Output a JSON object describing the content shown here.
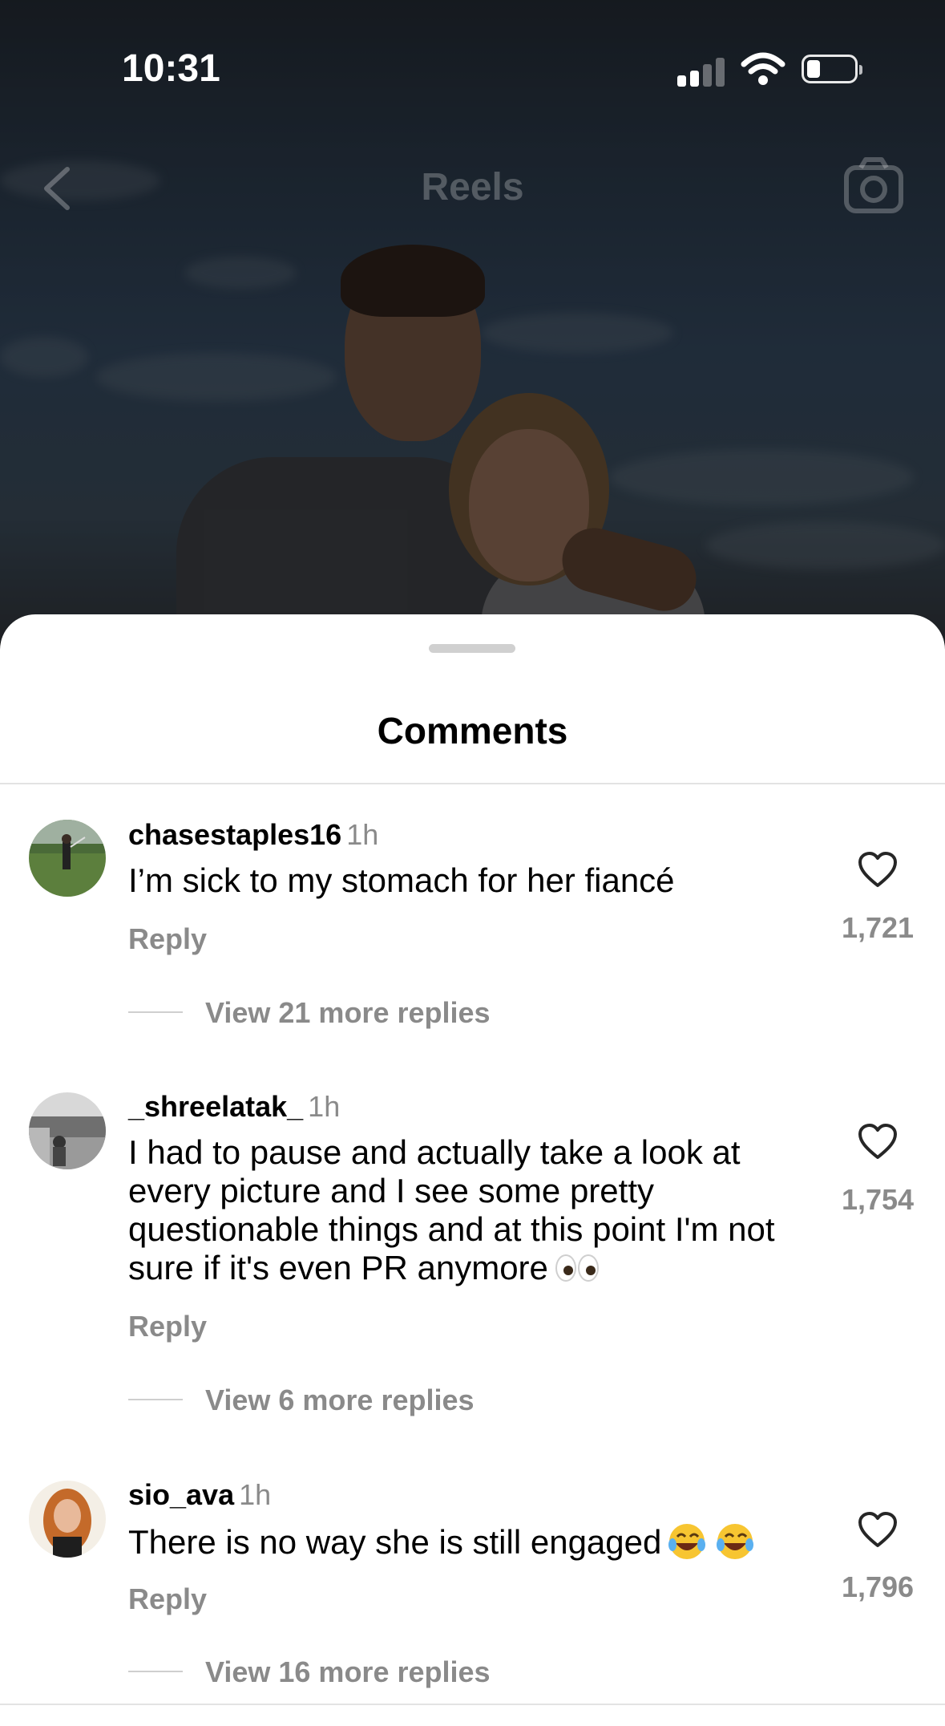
{
  "status_bar": {
    "time": "10:31"
  },
  "nav": {
    "title": "Reels",
    "back_icon": "chevron-left-icon",
    "camera_icon": "camera-icon"
  },
  "sheet": {
    "title": "Comments"
  },
  "comments": [
    {
      "username": "chasestaples16",
      "time": "1h",
      "text": "I’m sick to my stomach for her fiancé",
      "reply_label": "Reply",
      "likes": "1,721",
      "view_replies": "View 21 more replies"
    },
    {
      "username": "_shreelatak_",
      "time": "1h",
      "text": "I had to pause and actually take a look at every picture and I see some pretty questionable things and at this point I'm not sure if it's even PR anymore",
      "emoji": "eyes-emoji",
      "reply_label": "Reply",
      "likes": "1,754",
      "view_replies": "View 6 more replies"
    },
    {
      "username": "sio_ava",
      "time": "1h",
      "text": "There is no way she is still engaged",
      "emoji": "laughing-tears-emoji",
      "reply_label": "Reply",
      "likes": "1,796",
      "view_replies": "View 16 more replies"
    }
  ]
}
